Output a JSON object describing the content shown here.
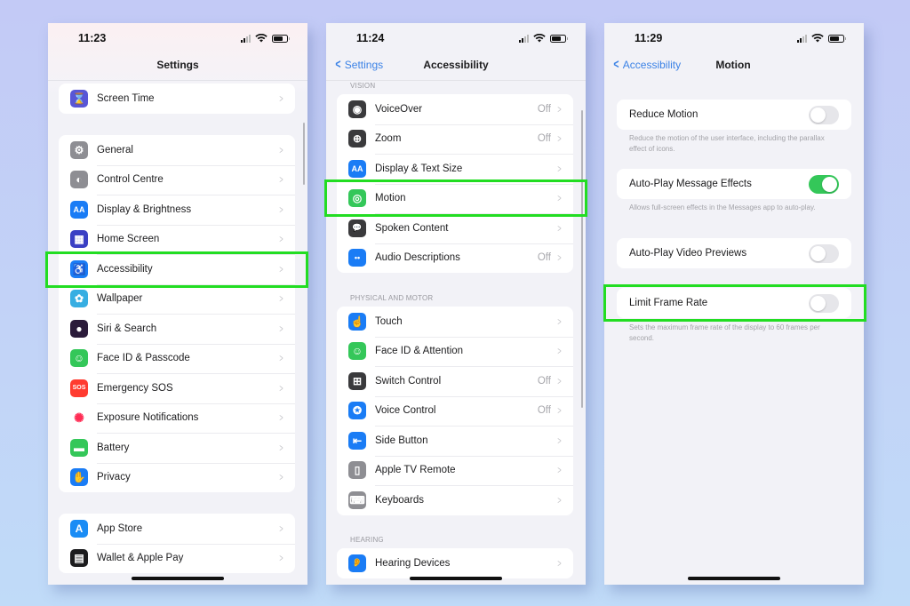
{
  "screens": [
    {
      "time": "11:23",
      "title": "Settings",
      "groups": [
        [
          {
            "label": "Screen Time",
            "icon": "hourglass-icon",
            "color": "#5856d6",
            "glyph": "⌛"
          }
        ],
        [
          {
            "label": "General",
            "icon": "gear-icon",
            "color": "#8e8e93",
            "glyph": "⚙"
          },
          {
            "label": "Control Centre",
            "icon": "toggles-icon",
            "color": "#8e8e93",
            "glyph": "◐"
          },
          {
            "label": "Display & Brightness",
            "icon": "text-size-icon",
            "color": "#1a7cf5",
            "glyph": "AA"
          },
          {
            "label": "Home Screen",
            "icon": "app-grid-icon",
            "color": "#3a3fc4",
            "glyph": "▦"
          },
          {
            "label": "Accessibility",
            "icon": "accessibility-icon",
            "color": "#1a7cf5",
            "glyph": "♿"
          },
          {
            "label": "Wallpaper",
            "icon": "flower-icon",
            "color": "#37aee2",
            "glyph": "✿"
          },
          {
            "label": "Siri & Search",
            "icon": "siri-icon",
            "color": "#2b1b3a",
            "glyph": "●"
          },
          {
            "label": "Face ID & Passcode",
            "icon": "face-id-icon",
            "color": "#34c759",
            "glyph": "☺"
          },
          {
            "label": "Emergency SOS",
            "icon": "sos-icon",
            "color": "#ff3b30",
            "glyph": "SOS"
          },
          {
            "label": "Exposure Notifications",
            "icon": "exposure-icon",
            "color": "#ffffff",
            "glyph": "✺",
            "glyphColor": "#ff2d55"
          },
          {
            "label": "Battery",
            "icon": "battery-icon",
            "color": "#34c759",
            "glyph": "▬"
          },
          {
            "label": "Privacy",
            "icon": "hand-icon",
            "color": "#1a7cf5",
            "glyph": "✋"
          }
        ],
        [
          {
            "label": "App Store",
            "icon": "app-store-icon",
            "color": "#1a8cf5",
            "glyph": "A"
          },
          {
            "label": "Wallet & Apple Pay",
            "icon": "wallet-icon",
            "color": "#1c1c1e",
            "glyph": "▤"
          }
        ]
      ],
      "highlighted": "Accessibility"
    },
    {
      "time": "11:24",
      "back": "Settings",
      "title": "Accessibility",
      "sections": [
        {
          "header": "VISION",
          "rows": [
            {
              "label": "VoiceOver",
              "value": "Off",
              "icon": "voiceover-icon",
              "color": "#3a3a3c",
              "glyph": "◉"
            },
            {
              "label": "Zoom",
              "value": "Off",
              "icon": "zoom-icon",
              "color": "#3a3a3c",
              "glyph": "⊕"
            },
            {
              "label": "Display & Text Size",
              "value": "",
              "icon": "text-size-icon",
              "color": "#1a7cf5",
              "glyph": "AA"
            },
            {
              "label": "Motion",
              "value": "",
              "icon": "motion-icon",
              "color": "#34c759",
              "glyph": "◎"
            },
            {
              "label": "Spoken Content",
              "value": "",
              "icon": "speech-bubble-icon",
              "color": "#3a3a3c",
              "glyph": "💬"
            },
            {
              "label": "Audio Descriptions",
              "value": "Off",
              "icon": "audio-description-icon",
              "color": "#1a7cf5",
              "glyph": "••"
            }
          ]
        },
        {
          "header": "PHYSICAL AND MOTOR",
          "rows": [
            {
              "label": "Touch",
              "value": "",
              "icon": "touch-icon",
              "color": "#1a7cf5",
              "glyph": "☝"
            },
            {
              "label": "Face ID & Attention",
              "value": "",
              "icon": "face-id-icon",
              "color": "#34c759",
              "glyph": "☺"
            },
            {
              "label": "Switch Control",
              "value": "Off",
              "icon": "switch-control-icon",
              "color": "#3a3a3c",
              "glyph": "⊞"
            },
            {
              "label": "Voice Control",
              "value": "Off",
              "icon": "voice-control-icon",
              "color": "#1a7cf5",
              "glyph": "✪"
            },
            {
              "label": "Side Button",
              "value": "",
              "icon": "side-button-icon",
              "color": "#1a7cf5",
              "glyph": "⇤"
            },
            {
              "label": "Apple TV Remote",
              "value": "",
              "icon": "remote-icon",
              "color": "#8e8e93",
              "glyph": "▯"
            },
            {
              "label": "Keyboards",
              "value": "",
              "icon": "keyboard-icon",
              "color": "#8e8e93",
              "glyph": "⌨"
            }
          ]
        },
        {
          "header": "HEARING",
          "rows": [
            {
              "label": "Hearing Devices",
              "value": "",
              "icon": "ear-icon",
              "color": "#1a7cf5",
              "glyph": "👂"
            }
          ]
        }
      ],
      "highlighted": "Motion"
    },
    {
      "time": "11:29",
      "back": "Accessibility",
      "title": "Motion",
      "toggles": [
        {
          "label": "Reduce Motion",
          "on": false,
          "footnote": "Reduce the motion of the user interface, including the parallax effect of icons."
        },
        {
          "label": "Auto-Play Message Effects",
          "on": true,
          "footnote": "Allows full-screen effects in the Messages app to auto-play."
        },
        {
          "label": "Auto-Play Video Previews",
          "on": false,
          "footnote": ""
        },
        {
          "label": "Limit Frame Rate",
          "on": false,
          "footnote": "Sets the maximum frame rate of the display to 60 frames per second."
        }
      ],
      "highlighted": "Limit Frame Rate"
    }
  ],
  "colors": {
    "highlight": "#22dd22",
    "accent": "#3b82e6",
    "toggle_on": "#34c759"
  }
}
